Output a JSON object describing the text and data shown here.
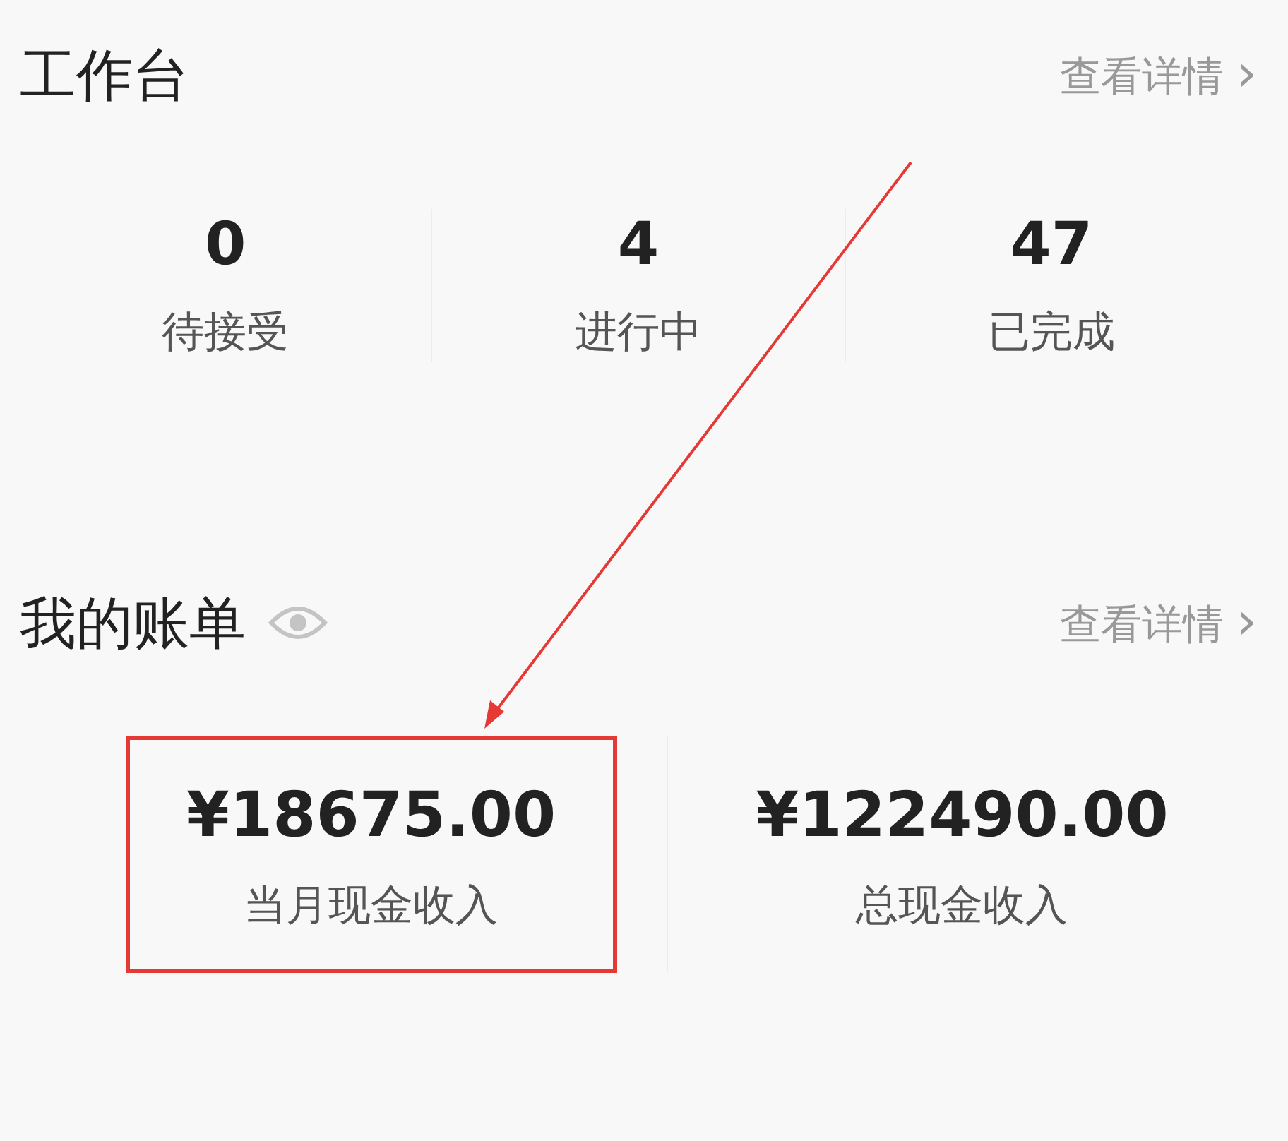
{
  "workbench": {
    "title": "工作台",
    "link": "查看详情",
    "link_arrow": "›",
    "stats": [
      {
        "value": "0",
        "label": "待接受"
      },
      {
        "value": "4",
        "label": "进行中"
      },
      {
        "value": "47",
        "label": "已完成"
      }
    ]
  },
  "bill": {
    "title": "我的账单",
    "link": "查看详情",
    "link_arrow": "›",
    "items": [
      {
        "amount": "¥18675.00",
        "label": "当月现金收入",
        "highlighted": true
      },
      {
        "amount": "¥122490.00",
        "label": "总现金收入",
        "highlighted": false
      }
    ]
  }
}
